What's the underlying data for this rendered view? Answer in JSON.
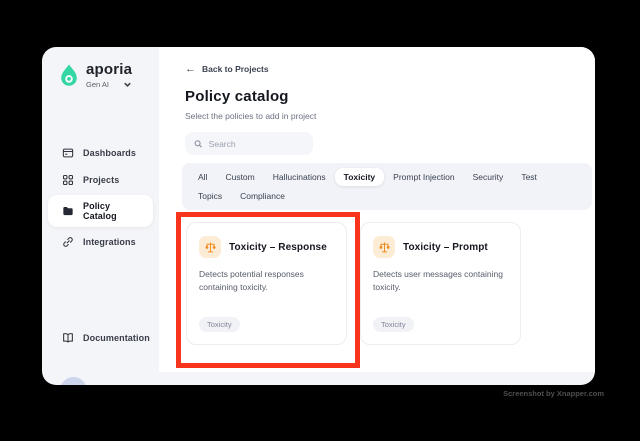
{
  "sidebar": {
    "brand": "aporia",
    "workspace": "Gen AI",
    "items": [
      {
        "label": "Dashboards",
        "selected": false
      },
      {
        "label": "Projects",
        "selected": false
      },
      {
        "label": "Policy Catalog",
        "selected": true
      },
      {
        "label": "Integrations",
        "selected": false
      }
    ],
    "footer_item": {
      "label": "Documentation"
    }
  },
  "main": {
    "back_link": "Back to Projects",
    "back_arrow": "←",
    "title": "Policy catalog",
    "subtitle": "Select the policies to add in project",
    "search": {
      "placeholder": "Search"
    },
    "tabs": [
      {
        "label": "All",
        "active": false
      },
      {
        "label": "Custom",
        "active": false
      },
      {
        "label": "Hallucinations",
        "active": false
      },
      {
        "label": "Toxicity",
        "active": true
      },
      {
        "label": "Prompt Injection",
        "active": false
      },
      {
        "label": "Security",
        "active": false
      },
      {
        "label": "Test",
        "active": false
      },
      {
        "label": "Topics",
        "active": false
      },
      {
        "label": "Compliance",
        "active": false
      }
    ],
    "cards": [
      {
        "title": "Toxicity – Response",
        "description": "Detects potential responses containing toxicity.",
        "tag": "Toxicity",
        "highlighted": true
      },
      {
        "title": "Toxicity – Prompt",
        "description": "Detects user messages containing toxicity.",
        "tag": "Toxicity",
        "highlighted": false
      }
    ]
  },
  "watermark": "Screenshot by Xnapper.com",
  "colors": {
    "brand_green": "#35d6a6",
    "card_icon_orange": "#ef8a1f",
    "card_icon_bg": "#fcecd5",
    "annotation_red": "#f8341c",
    "sidebar_bg": "#f4f5f8",
    "tab_bar_bg": "#f2f3f8"
  }
}
